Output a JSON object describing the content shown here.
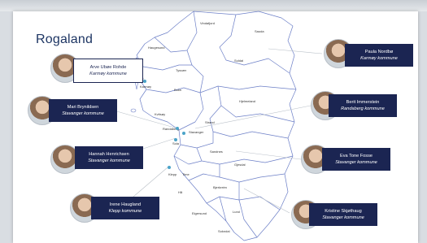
{
  "title": "Rogaland",
  "people": [
    {
      "id": "arve",
      "name": "Arve Ubøe Rohde",
      "municipality": "Karmøy kommune",
      "highlight": true
    },
    {
      "id": "mari",
      "name": "Mari Brynildsen",
      "municipality": "Stavanger kommune",
      "highlight": false
    },
    {
      "id": "hannah",
      "name": "Hannah Henrichsen",
      "municipality": "Stavanger kommune",
      "highlight": false
    },
    {
      "id": "irene",
      "name": "Irene Haugland",
      "municipality": "Klepp kommune",
      "highlight": false
    },
    {
      "id": "paula",
      "name": "Paula Nordbø",
      "municipality": "Karmøy kommune",
      "highlight": false
    },
    {
      "id": "berit",
      "name": "Berit Immerstein",
      "municipality": "Randaberg kommune",
      "highlight": false
    },
    {
      "id": "eva",
      "name": "Eva Tone Fosse",
      "municipality": "Stavanger kommune",
      "highlight": false
    },
    {
      "id": "kristine",
      "name": "Kristine Skjøthaug",
      "municipality": "Stavanger kommune",
      "highlight": false
    }
  ],
  "map_places": [
    "Sauda",
    "Vindafjord",
    "Haugesund",
    "Tysvær",
    "Utsira",
    "Karmøy",
    "Suldal",
    "Bokn",
    "Hjelmeland",
    "Kvitsøy",
    "Randaberg",
    "Stavanger",
    "Strand",
    "Sola",
    "Sandnes",
    "Gjesdal",
    "Klepp",
    "Time",
    "Hå",
    "Bjerkreim",
    "Eigersund",
    "Lund",
    "Sokndal"
  ],
  "colors": {
    "label_bg": "#1b2552",
    "title": "#1d3563",
    "map_line": "#6c7fc7",
    "dot": "#4aa3c8"
  }
}
